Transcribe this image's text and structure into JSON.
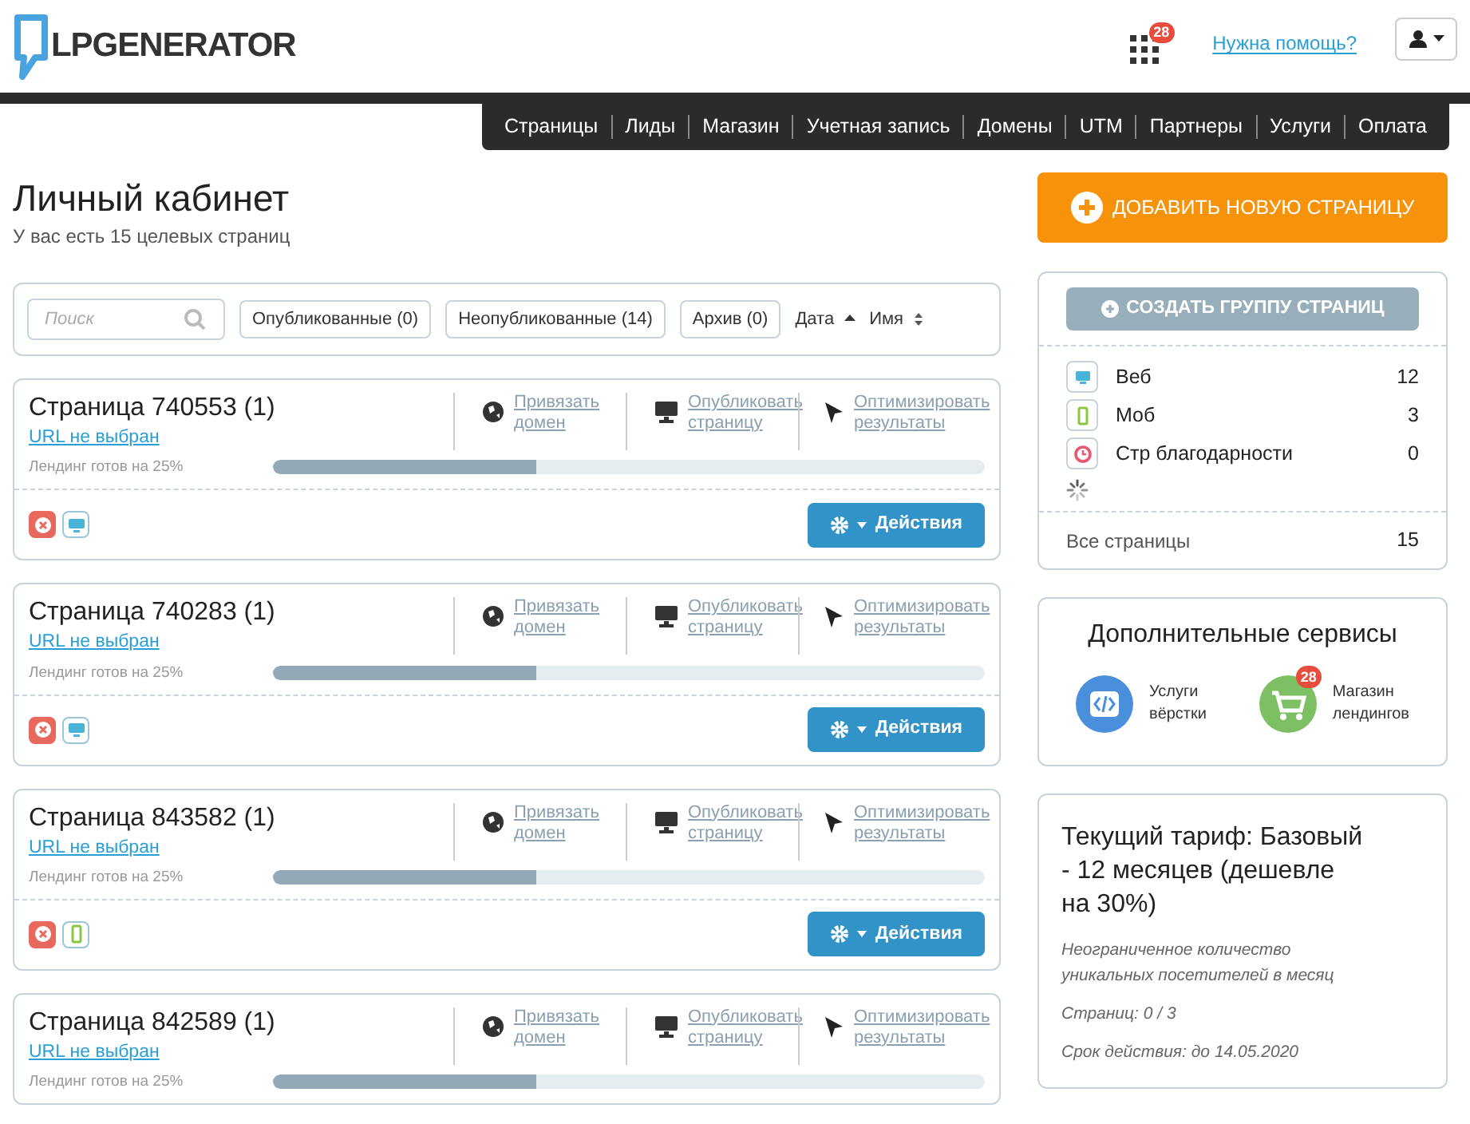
{
  "header": {
    "logo": "LPGENERATOR",
    "apps_badge": "28",
    "help_link": "Нужна помощь?"
  },
  "nav": [
    "Страницы",
    "Лиды",
    "Магазин",
    "Учетная запись",
    "Домены",
    "UTM",
    "Партнеры",
    "Услуги",
    "Оплата"
  ],
  "page": {
    "title": "Личный кабинет",
    "subtitle": "У вас есть 15 целевых страниц"
  },
  "filters": {
    "search": {
      "placeholder": "Поиск"
    },
    "buttons": [
      "Опубликованные (0)",
      "Неопубликованные (14)",
      "Архив (0)"
    ],
    "sorts": [
      {
        "label": "Дата",
        "kind": "asc"
      },
      {
        "label": "Имя",
        "kind": "both"
      }
    ]
  },
  "cards": [
    {
      "title": "Страница 740553 (1)",
      "url": "URL не выбран",
      "actions": [
        {
          "kind": "globe",
          "label": "Привязать домен"
        },
        {
          "kind": "monitor",
          "label": "Опубликовать страницу"
        },
        {
          "kind": "cursor",
          "label": "Оптимизировать результаты"
        }
      ],
      "ready": "Лендинг готов на 25%",
      "level": 0.37,
      "tags": [
        {
          "kind": "error"
        },
        {
          "kind": "web"
        }
      ],
      "button": "Действия"
    },
    {
      "title": "Страница 740283 (1)",
      "url": "URL не выбран",
      "actions": [
        {
          "kind": "globe",
          "label": "Привязать домен"
        },
        {
          "kind": "monitor",
          "label": "Опубликовать страницу"
        },
        {
          "kind": "cursor",
          "label": "Оптимизировать результаты"
        }
      ],
      "ready": "Лендинг готов на 25%",
      "level": 0.37,
      "tags": [
        {
          "kind": "error"
        },
        {
          "kind": "web"
        }
      ],
      "button": "Действия"
    },
    {
      "title": "Страница 843582 (1)",
      "url": "URL не выбран",
      "actions": [
        {
          "kind": "globe",
          "label": "Привязать домен"
        },
        {
          "kind": "monitor",
          "label": "Опубликовать страницу"
        },
        {
          "kind": "cursor",
          "label": "Оптимизировать результаты"
        }
      ],
      "ready": "Лендинг готов на 25%",
      "level": 0.37,
      "tags": [
        {
          "kind": "error"
        },
        {
          "kind": "mobile"
        }
      ],
      "button": "Действия"
    },
    {
      "title": "Страница 842589 (1)",
      "url": "URL не выбран",
      "actions": [
        {
          "kind": "globe",
          "label": "Привязать домен"
        },
        {
          "kind": "monitor",
          "label": "Опубликовать страницу"
        },
        {
          "kind": "cursor",
          "label": "Оптимизировать результаты"
        }
      ],
      "ready": "Лендинг готов на 25%",
      "level": 0.37
    }
  ],
  "add_button": "ДОБАВИТЬ НОВУЮ СТРАНИЦУ",
  "groups": {
    "button": "СОЗДАТЬ ГРУППУ СТРАНИЦ",
    "items": [
      {
        "kind": "web",
        "label": "Веб",
        "count": "12"
      },
      {
        "kind": "mobile",
        "label": "Моб",
        "count": "3"
      },
      {
        "kind": "thanks",
        "label": "Стр благодарности",
        "count": "0"
      }
    ],
    "total_label": "Все страницы",
    "total_count": "15"
  },
  "services": {
    "title": "Дополнительные сервисы",
    "items": [
      {
        "kind": "code",
        "label": "Услуги вёрстки"
      },
      {
        "kind": "cart",
        "label": "Магазин лендингов",
        "badge": "28"
      }
    ]
  },
  "tariff": {
    "title": "Текущий тариф: Базовый - 12 месяцев (дешевле на 30%)",
    "lines": [
      "Неограниченное количество уникальных посетителей в месяц",
      "Страниц: 0 / 3",
      "Срок действия: до 14.05.2020"
    ]
  }
}
